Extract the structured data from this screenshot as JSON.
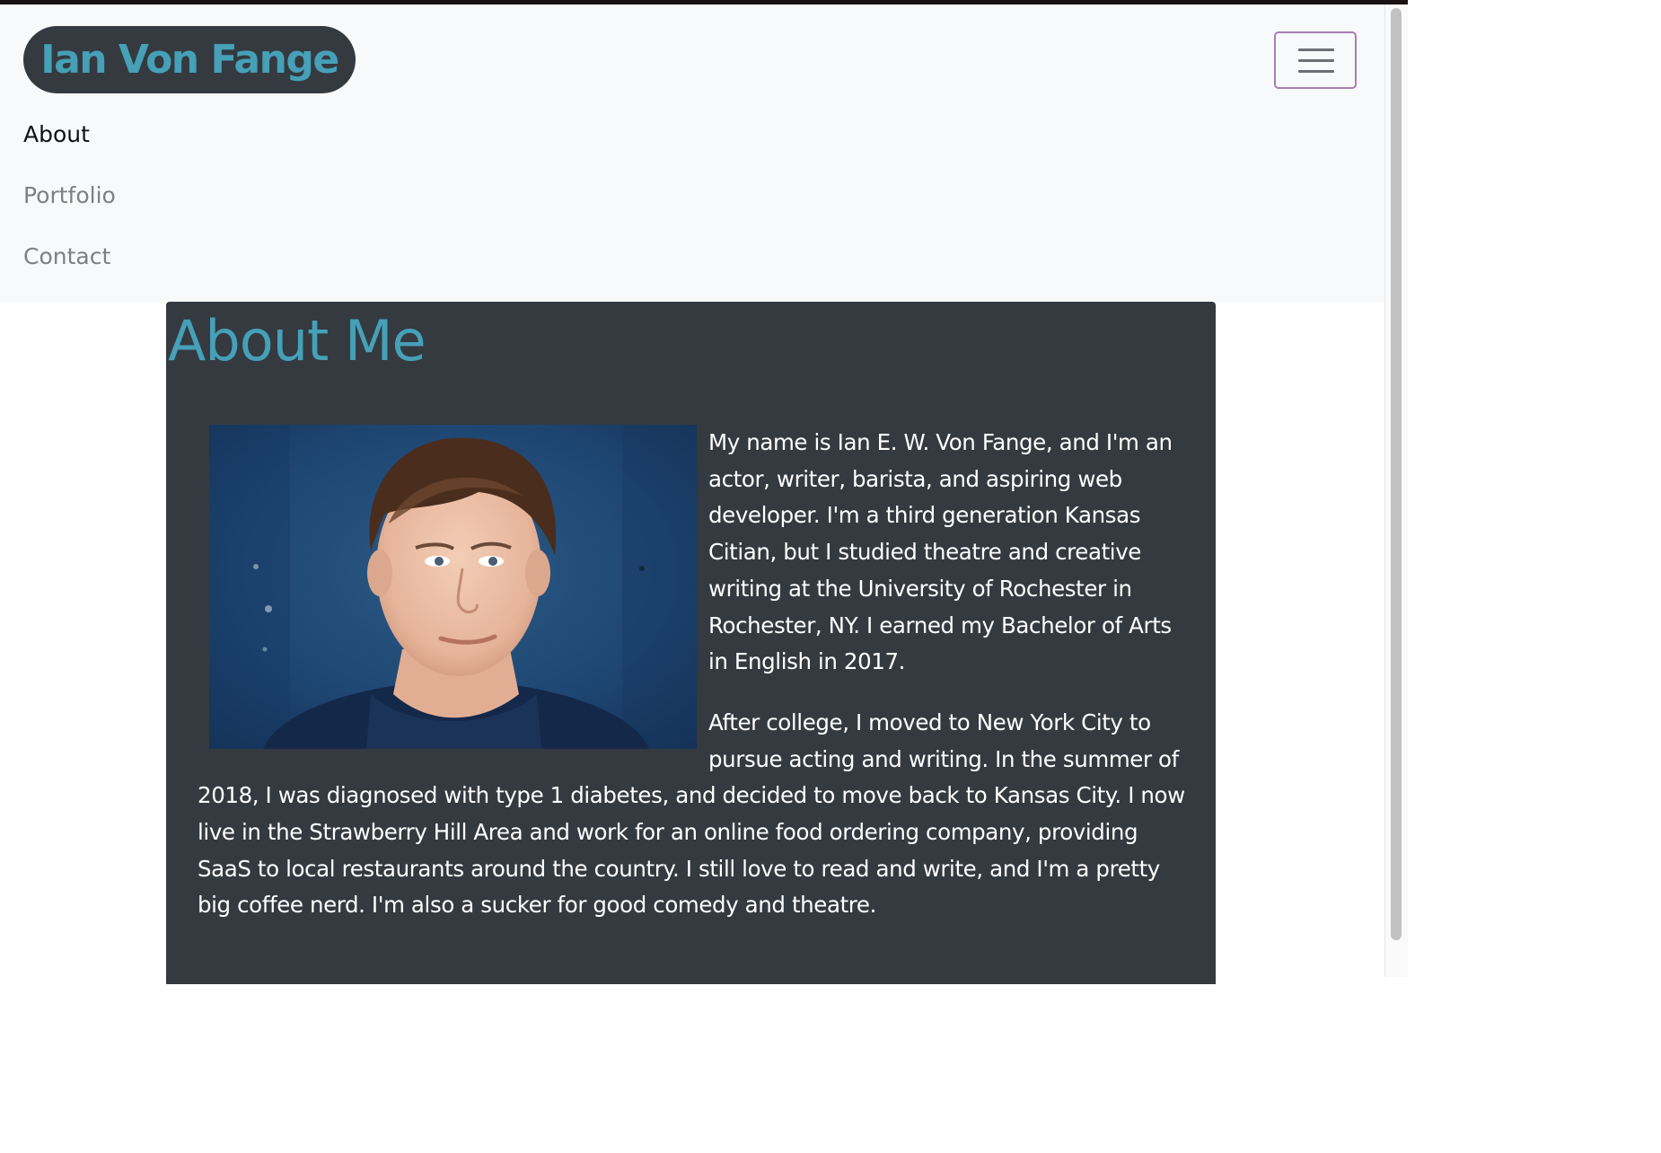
{
  "navbar": {
    "brand": "Ian Von Fange",
    "links": [
      {
        "label": "About",
        "active": true
      },
      {
        "label": "Portfolio",
        "active": false
      },
      {
        "label": "Contact",
        "active": false
      }
    ],
    "toggler_icon": "hamburger-icon"
  },
  "about": {
    "heading": "About Me",
    "photo_icon": "headshot-photo",
    "paragraphs": [
      "My name is Ian E. W. Von Fange, and I'm an actor, writer, barista, and aspiring web developer. I'm a third generation Kansas Citian, but I studied theatre and creative writing at the University of Rochester in Rochester, NY. I earned my Bachelor of Arts in English in 2017.",
      "After college, I moved to New York City to pursue acting and writing. In the summer of 2018, I was diagnosed with type 1 diabetes, and decided to move back to Kansas City. I now live in the Strawberry Hill Area and work for an online food ordering company, providing SaaS to local restaurants around the country. I still love to read and write, and I'm a pretty big coffee nerd. I'm also a sucker for good comedy and theatre."
    ]
  },
  "colors": {
    "accent": "#46a0b7",
    "card_bg": "#343a40",
    "navbar_bg": "#f8f9fa",
    "toggler_border": "#a87cb6"
  }
}
